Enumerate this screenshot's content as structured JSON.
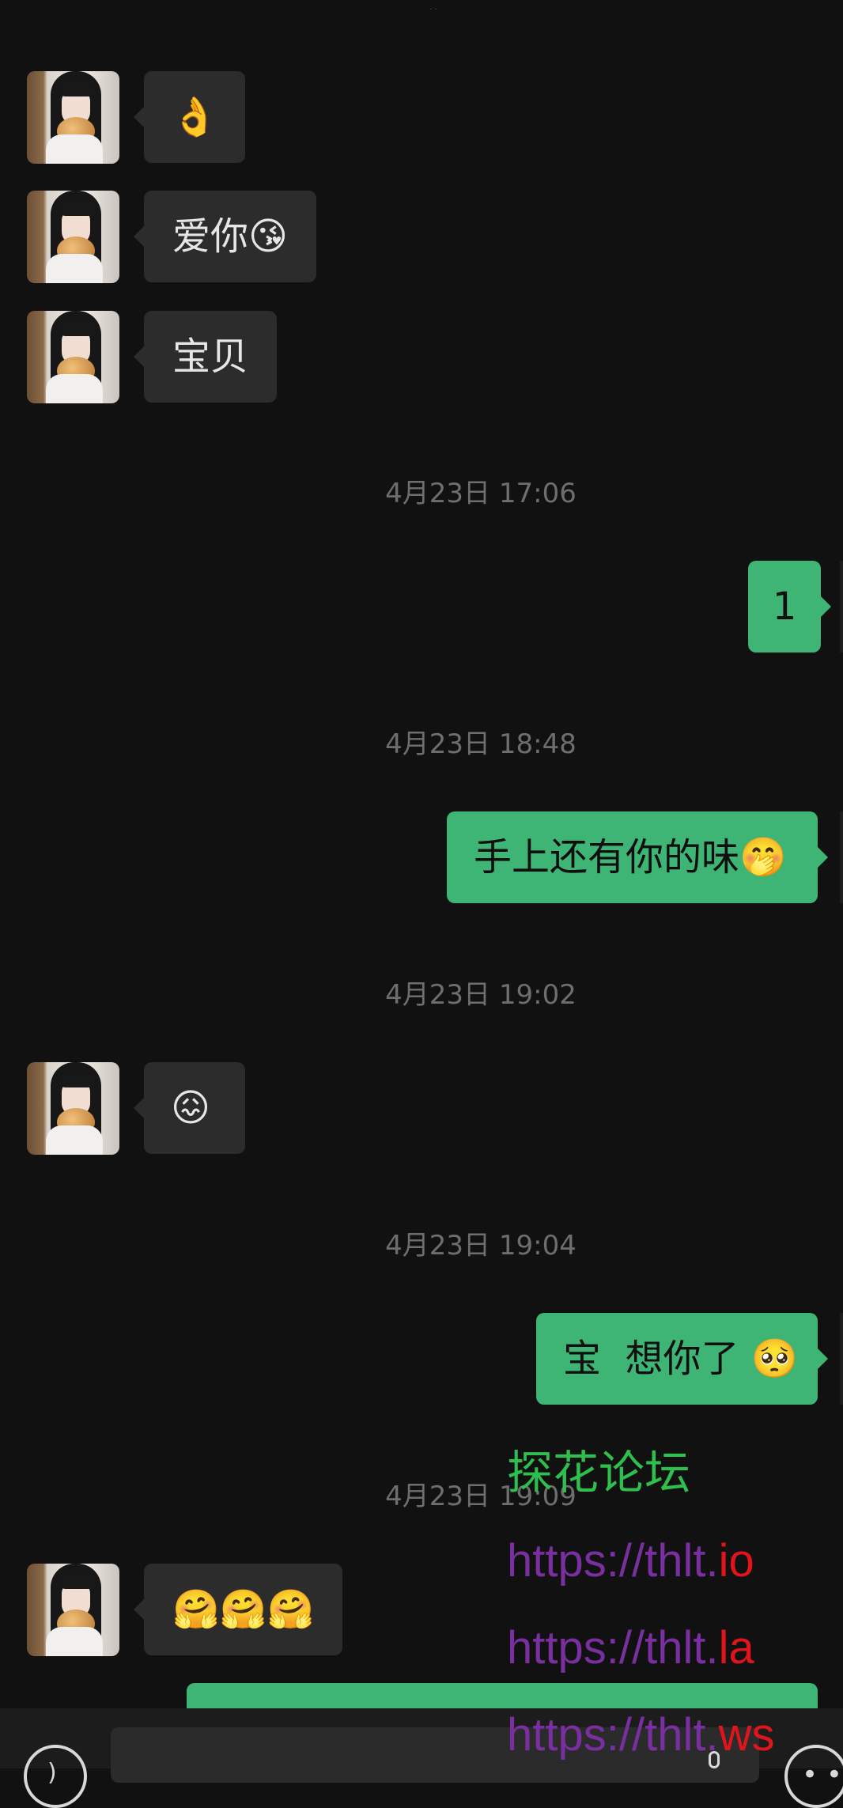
{
  "status_indicator": "· ·",
  "messages": [
    {
      "type": "received",
      "text": "👌"
    },
    {
      "type": "received",
      "text": "爱你😘"
    },
    {
      "type": "received",
      "text": "宝贝"
    },
    {
      "type": "timestamp",
      "text": "4月23日 17:06"
    },
    {
      "type": "sent",
      "text": "1"
    },
    {
      "type": "timestamp",
      "text": "4月23日 18:48"
    },
    {
      "type": "sent",
      "text": "手上还有你的味🤭"
    },
    {
      "type": "timestamp",
      "text": "4月23日 19:02"
    },
    {
      "type": "received",
      "text": "😖"
    },
    {
      "type": "timestamp",
      "text": "4月23日 19:04"
    },
    {
      "type": "sent",
      "text": "宝  想你了 🥺"
    },
    {
      "type": "timestamp",
      "text": "4月23日 19:09"
    },
    {
      "type": "received",
      "text": "🤗🤗🤗"
    }
  ],
  "watermark": {
    "title": "探花论坛",
    "links": [
      {
        "base": "https://thlt.",
        "tld": "io"
      },
      {
        "base": "https://thlt.",
        "tld": "la"
      },
      {
        "base": "https://thlt.",
        "tld": "ws"
      }
    ]
  },
  "input_bar": {
    "voice_icon": "voice-icon",
    "emoji_icon": "emoji-icon"
  },
  "colors": {
    "background": "#111111",
    "received_bubble": "#2c2c2c",
    "sent_bubble": "#3eb575",
    "timestamp": "#6e6e6e",
    "watermark_title": "#2fbf4e",
    "watermark_link": "#7a2fa0",
    "watermark_tld": "#e0141b"
  }
}
